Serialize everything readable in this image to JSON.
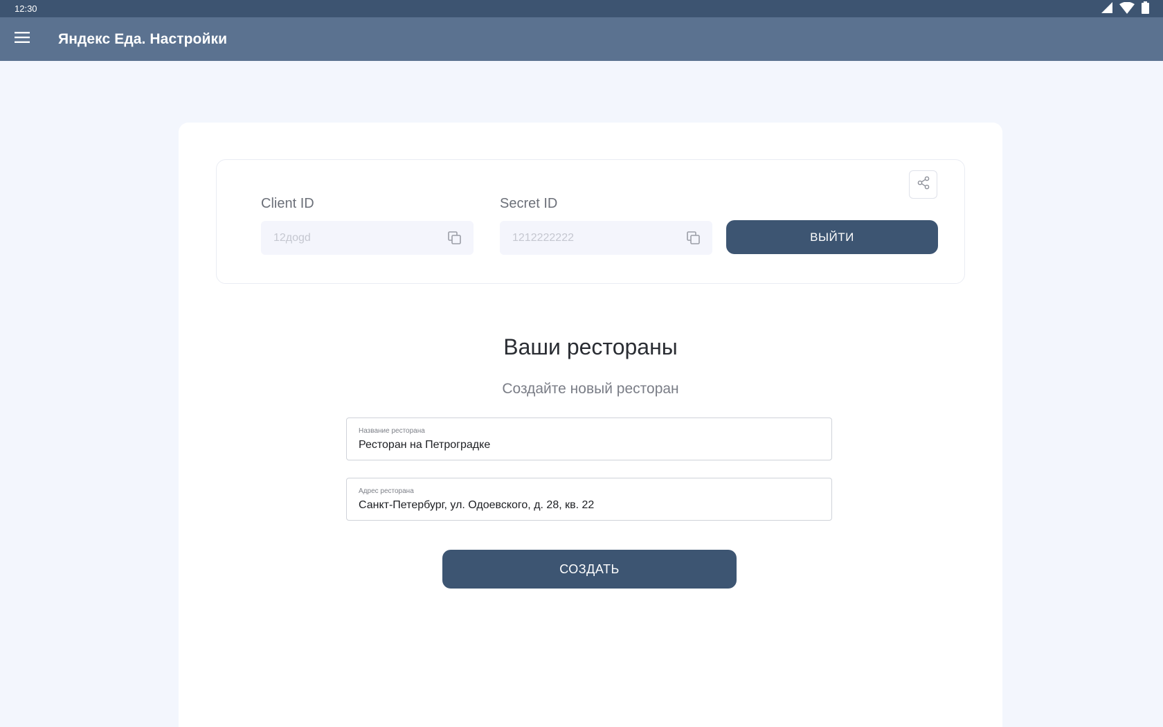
{
  "status_bar": {
    "time": "12:30",
    "icons": [
      "signal-icon",
      "wifi-icon",
      "battery-icon"
    ]
  },
  "app_bar": {
    "title": "Яндекс Еда. Настройки",
    "menu_icon": "menu-icon"
  },
  "credentials": {
    "client_id": {
      "label": "Client ID",
      "value": "12дogd"
    },
    "secret_id": {
      "label": "Secret ID",
      "value": "1212222222"
    },
    "logout_label": "ВЫЙТИ",
    "share_icon": "share-icon",
    "copy_icon": "copy-icon"
  },
  "restaurants": {
    "title": "Ваши рестораны",
    "subtitle": "Создайте новый ресторан",
    "name_field": {
      "label": "Название ресторана",
      "value": "Ресторан на Петроградке"
    },
    "address_field": {
      "label": "Адрес ресторана",
      "value": "Санкт-Петербург, ул. Одоевского, д. 28, кв. 22"
    },
    "create_label": "СОЗДАТЬ"
  },
  "colors": {
    "status_bar": "#3d5471",
    "app_bar": "#5b7290",
    "background": "#f3f6fd",
    "primary_button": "#3d5572"
  }
}
